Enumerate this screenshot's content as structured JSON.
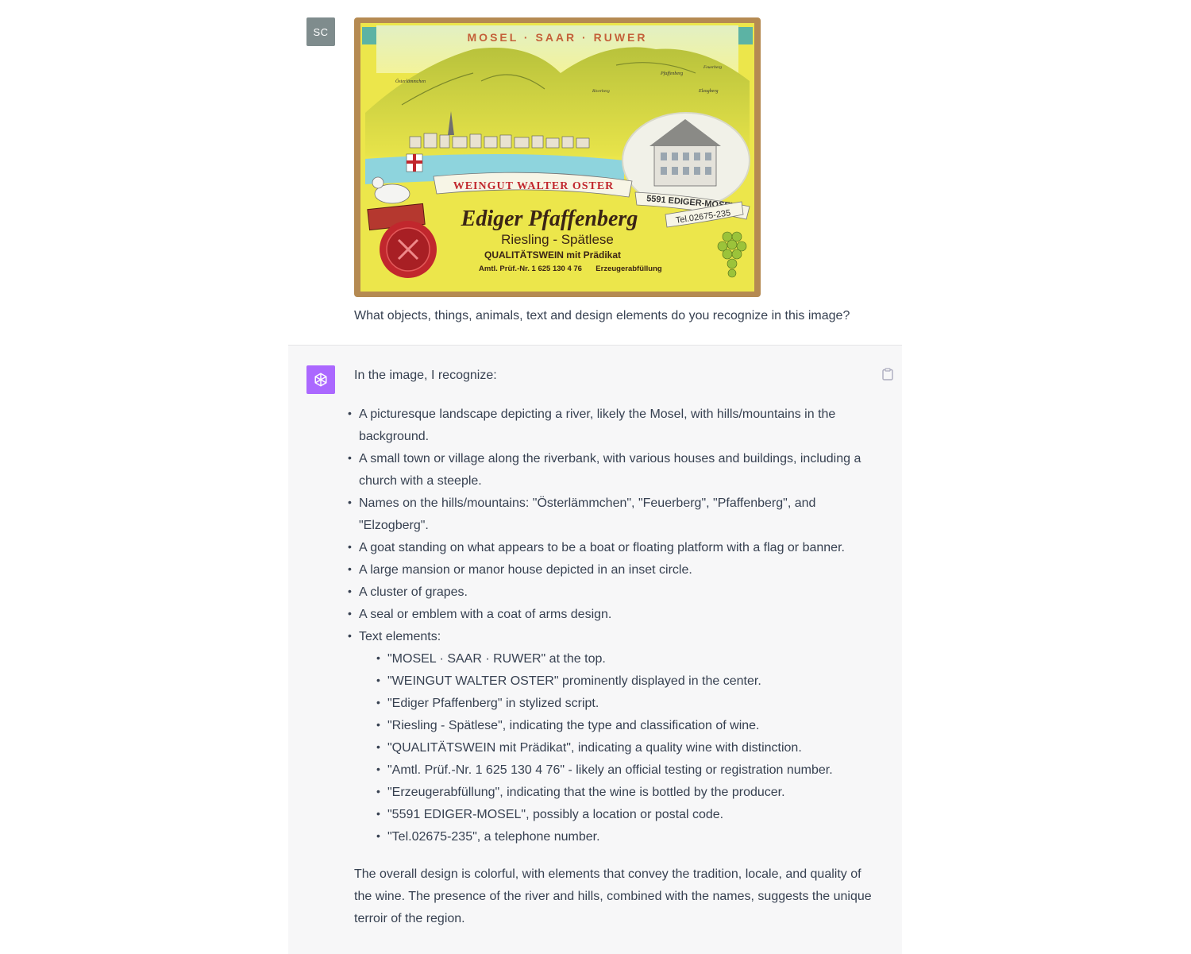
{
  "user": {
    "avatar_initials": "SC",
    "question": "What objects, things, animals, text and design elements do you recognize in this image?"
  },
  "label": {
    "region": "MOSEL · SAAR · RUWER",
    "hill_osterlammchen": "Österlämmchen",
    "hill_feuerberg": "Feuerberg",
    "hill_pfaffenberg": "Pfaffenberg",
    "hill_elzogberg": "Elzogberg",
    "hill_riverberg": "Riverberg",
    "winery": "WEINGUT WALTER OSTER",
    "vineyard": "Ediger Pfaffenberg",
    "variety": "Riesling - Spätlese",
    "quality": "QUALITÄTSWEIN mit Prädikat",
    "ap_number": "Amtl. Prüf.-Nr. 1 625 130 4 76",
    "bottler": "Erzeugerabfüllung",
    "address": "5591 EDIGER-MOSEL",
    "phone": "Tel.02675-235"
  },
  "assistant": {
    "intro": "In the image, I recognize:",
    "bullets": [
      {
        "line1": "A picturesque landscape depicting a river, likely the Mosel, with hills/mountains in the",
        "line2": "background."
      },
      {
        "line1": "A small town or village along the riverbank, with various houses and buildings, including a",
        "line2": "church with a steeple."
      },
      {
        "line1": "Names on the hills/mountains: \"Österlämmchen\", \"Feuerberg\", \"Pfaffenberg\", and",
        "line2": "\"Elzogberg\"."
      },
      {
        "line1": "A goat standing on what appears to be a boat or floating platform with a flag or banner."
      },
      {
        "line1": "A large mansion or manor house depicted in an inset circle."
      },
      {
        "line1": "A cluster of grapes."
      },
      {
        "line1": "A seal or emblem with a coat of arms design."
      },
      {
        "line1": "Text elements:"
      }
    ],
    "text_elements": [
      "\"MOSEL · SAAR · RUWER\" at the top.",
      "\"WEINGUT WALTER OSTER\" prominently displayed in the center.",
      "\"Ediger Pfaffenberg\" in stylized script.",
      "\"Riesling - Spätlese\", indicating the type and classification of wine.",
      "\"QUALITÄTSWEIN mit Prädikat\", indicating a quality wine with distinction.",
      "\"Amtl. Prüf.-Nr. 1 625 130 4 76\" - likely an official testing or registration number.",
      "\"Erzeugerabfüllung\", indicating that the wine is bottled by the producer.",
      "\"5591 EDIGER-MOSEL\", possibly a location or postal code.",
      "\"Tel.02675-235\", a telephone number."
    ],
    "closing": [
      "The overall design is colorful, with elements that convey the tradition, locale, and quality of",
      "the wine. The presence of the river and hills, combined with the names, suggests the unique",
      "terroir of the region."
    ]
  },
  "colors": {
    "assistant_avatar": "#ab68ff",
    "user_avatar": "#7f8c8d",
    "assistant_bg": "#f7f7f8",
    "label_yellow": "#e9e64a",
    "label_red": "#c1272d"
  },
  "icons": {
    "assistant_avatar": "openai-logo-icon",
    "copy": "clipboard-icon"
  }
}
